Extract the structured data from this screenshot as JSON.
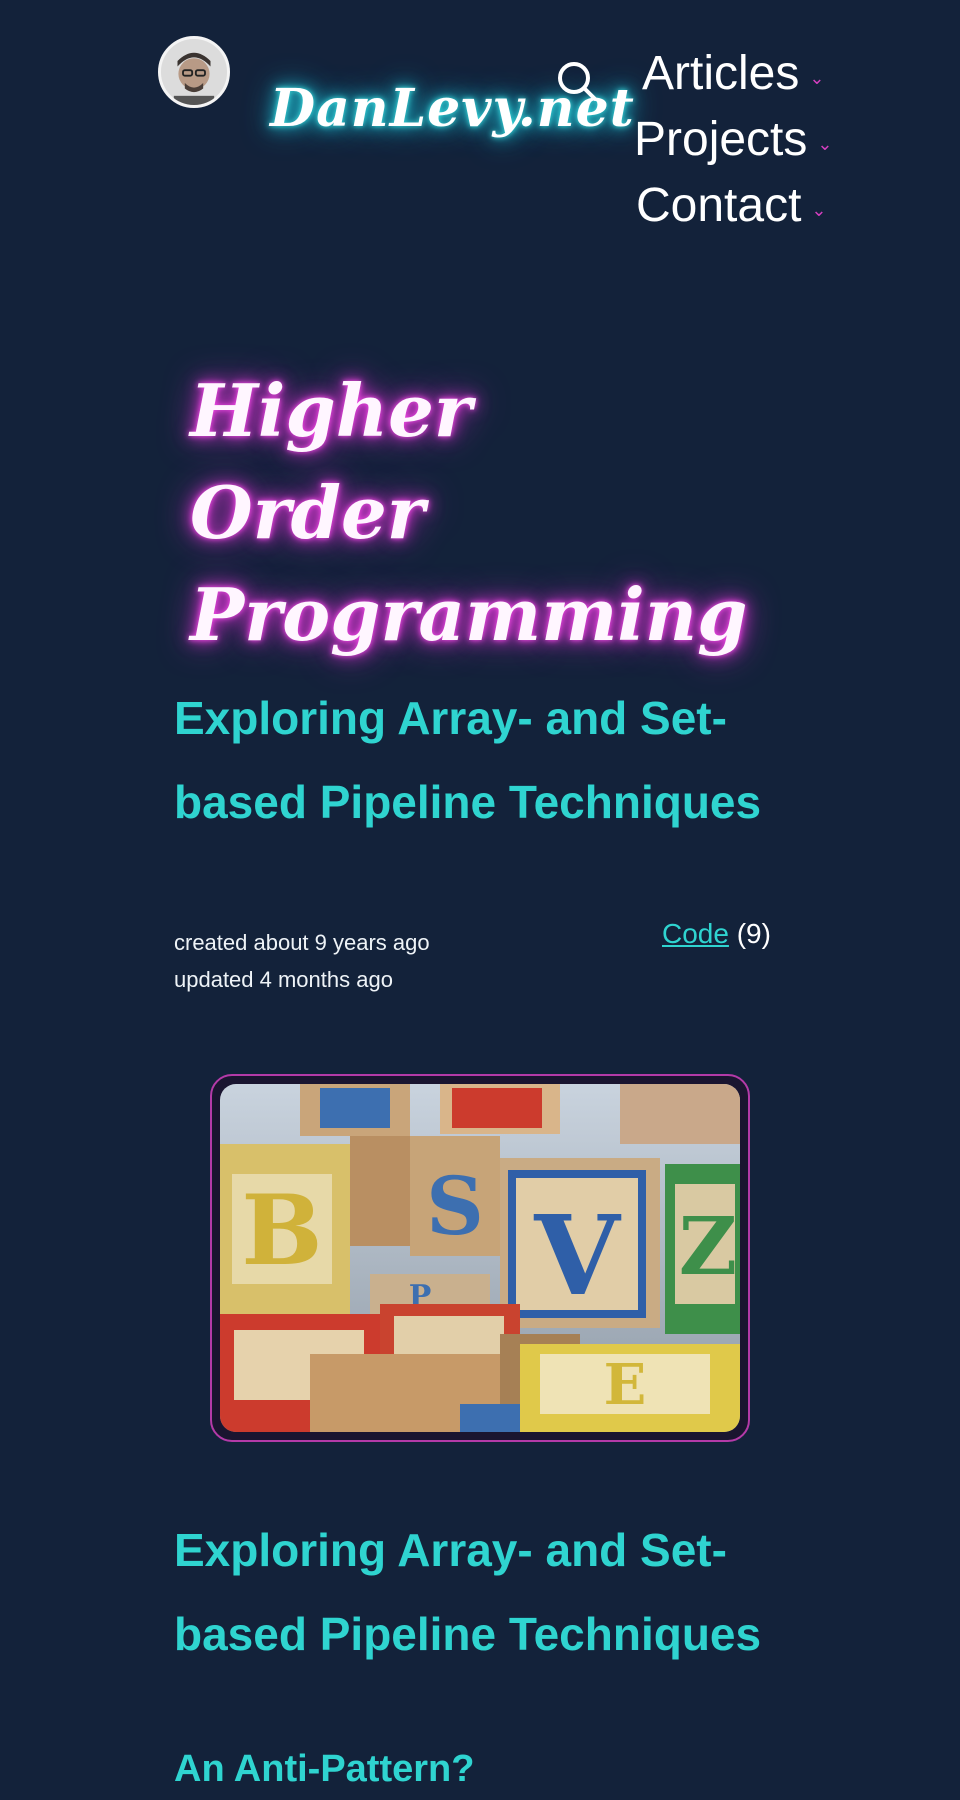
{
  "header": {
    "site_name": "DanLevy.net",
    "nav": [
      {
        "label": "Articles"
      },
      {
        "label": "Projects"
      },
      {
        "label": "Contact"
      }
    ]
  },
  "hero": {
    "title_line1": "Higher Order",
    "title_line2": "Programming"
  },
  "article": {
    "title_line1": "Exploring Array- and Set-",
    "title_line2": "based Pipeline Techniques",
    "created": "created about 9 years ago",
    "updated": "updated 4 months ago",
    "tag_label": "Code",
    "tag_count": "(9)",
    "image_alt": "Wooden alphabet blocks",
    "body_heading_line1": "Exploring Array- and Set-",
    "body_heading_line2": "based Pipeline Techniques",
    "subheading": "An Anti-Pattern?"
  },
  "colors": {
    "background": "#13223a",
    "accent_cyan": "#2fd4d0",
    "accent_magenta": "#d43fbf"
  }
}
